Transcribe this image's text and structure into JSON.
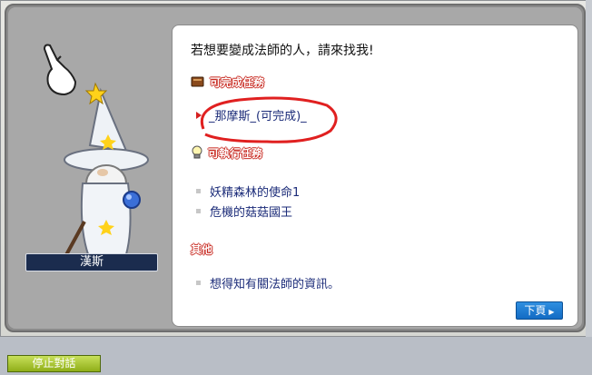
{
  "npc": {
    "name": "漢斯"
  },
  "dialog": {
    "intro": "若想要變成法師的人，請來找我!",
    "completable_section": {
      "label": "可完成任務",
      "items": [
        "_那摩斯_(可完成)_"
      ]
    },
    "available_section": {
      "label": "可執行任務",
      "items": [
        "妖精森林的使命1",
        "危機的菇菇國王"
      ]
    },
    "other_section": {
      "label": "其他",
      "items": [
        "想得知有關法師的資訊。"
      ]
    },
    "next_button": "下頁"
  },
  "footer": {
    "stop_button": "停止對話"
  },
  "colors": {
    "highlight_circle": "#e02020",
    "section_title": "#ff5a5a"
  }
}
